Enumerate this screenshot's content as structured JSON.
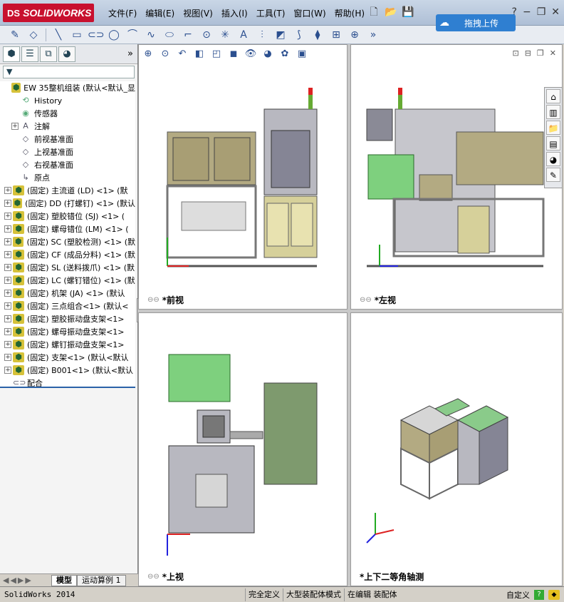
{
  "app": {
    "logo_ds": "DS",
    "logo_text": "SOLIDWORKS",
    "menu": [
      "文件(F)",
      "编辑(E)",
      "视图(V)",
      "插入(I)",
      "工具(T)",
      "窗口(W)",
      "帮助(H)"
    ],
    "upload_label": "拖拽上传"
  },
  "left_panel": {
    "filter_label": "▼",
    "tree": [
      {
        "label": "EW 35整机组装  (默认<默认_显",
        "icon": "assembly-icon",
        "exp": ""
      },
      {
        "label": "History",
        "icon": "history-icon",
        "exp": ""
      },
      {
        "label": "传感器",
        "icon": "sensor-icon",
        "exp": ""
      },
      {
        "label": "注解",
        "icon": "annotation-icon",
        "exp": "+"
      },
      {
        "label": "前视基准面",
        "icon": "plane-icon",
        "exp": ""
      },
      {
        "label": "上视基准面",
        "icon": "plane-icon",
        "exp": ""
      },
      {
        "label": "右视基准面",
        "icon": "plane-icon",
        "exp": ""
      },
      {
        "label": "原点",
        "icon": "origin-icon",
        "exp": ""
      },
      {
        "label": "(固定) 主流道 (LD) <1> (默",
        "icon": "part-icon",
        "exp": "+"
      },
      {
        "label": "(固定) DD (打螺钉) <1> (默认",
        "icon": "part-icon",
        "exp": "+"
      },
      {
        "label": "(固定) 塑胶错位 (SJ) <1> (",
        "icon": "part-icon",
        "exp": "+"
      },
      {
        "label": "(固定) 螺母错位 (LM) <1> (",
        "icon": "part-icon",
        "exp": "+"
      },
      {
        "label": "(固定) SC (塑胶检测) <1> (默",
        "icon": "part-icon",
        "exp": "+"
      },
      {
        "label": "(固定) CF (成品分料) <1> (默",
        "icon": "part-icon",
        "exp": "+"
      },
      {
        "label": "(固定) SL (送料拨爪) <1> (默",
        "icon": "part-icon",
        "exp": "+"
      },
      {
        "label": "(固定) LC (螺钉错位) <1> (默",
        "icon": "part-icon",
        "exp": "+"
      },
      {
        "label": "(固定) 机架 (JA) <1> (默认",
        "icon": "part-icon",
        "exp": "+"
      },
      {
        "label": "(固定) 三点组合<1> (默认<",
        "icon": "part-icon",
        "exp": "+"
      },
      {
        "label": "(固定) 塑胶振动盘支架<1>",
        "icon": "part-icon",
        "exp": "+"
      },
      {
        "label": "(固定) 螺母振动盘支架<1>",
        "icon": "part-icon",
        "exp": "+"
      },
      {
        "label": "(固定) 螺钉振动盘支架<1>",
        "icon": "part-icon",
        "exp": "+"
      },
      {
        "label": "(固定) 支架<1> (默认<默认",
        "icon": "part-icon",
        "exp": "+"
      },
      {
        "label": "(固定) B001<1> (默认<默认",
        "icon": "part-icon",
        "exp": "+"
      },
      {
        "label": "配合",
        "icon": "mate-icon",
        "exp": ""
      }
    ],
    "bottom_tabs": [
      "模型",
      "运动算例 1"
    ]
  },
  "viewports": {
    "front": "*前视",
    "left": "*左视",
    "top": "*上视",
    "iso": "*上下二等角轴测"
  },
  "status": {
    "app_name": "SolidWorks 2014",
    "cells": [
      "完全定义",
      "大型装配体模式",
      "在编辑 装配体"
    ],
    "custom": "自定义"
  }
}
